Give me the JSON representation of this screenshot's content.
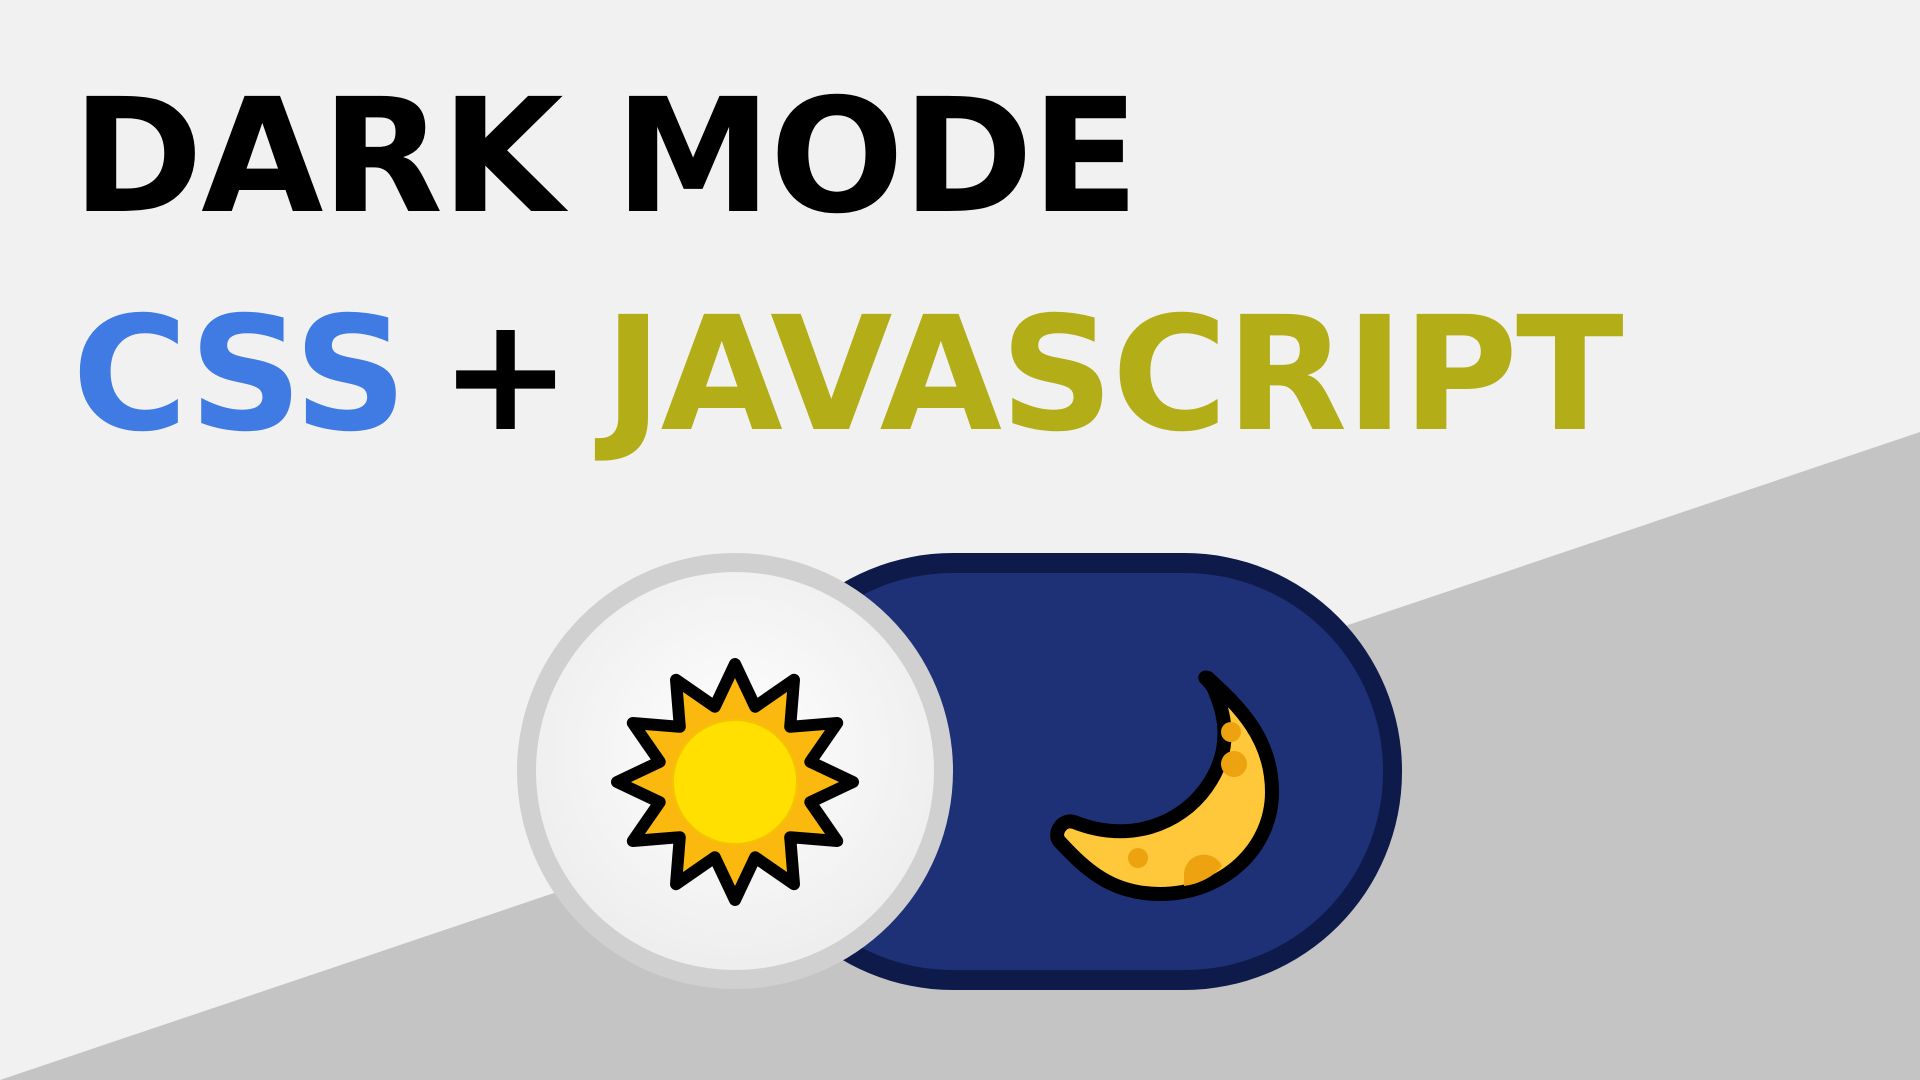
{
  "title": {
    "line1": "DARK MODE",
    "css": "CSS",
    "plus": "+",
    "js": "JAVASCRIPT"
  },
  "toggle": {
    "state": "light",
    "knob_icon": "sun-icon",
    "track_icon": "moon-icon"
  },
  "colors": {
    "background": "#f1f1f1",
    "diagonal_band": "#c4c4c4",
    "css_blue": "#3f7be3",
    "js_olive": "#b3ad18",
    "track_navy": "#1f3176",
    "track_border": "#0d1a4a",
    "knob_white": "#f3f3f3",
    "knob_ring": "#d0d0d0",
    "sun_yellow": "#ffe000",
    "sun_orange": "#fbb80e",
    "moon_yellow": "#ffc73a",
    "moon_spots": "#eda310"
  }
}
